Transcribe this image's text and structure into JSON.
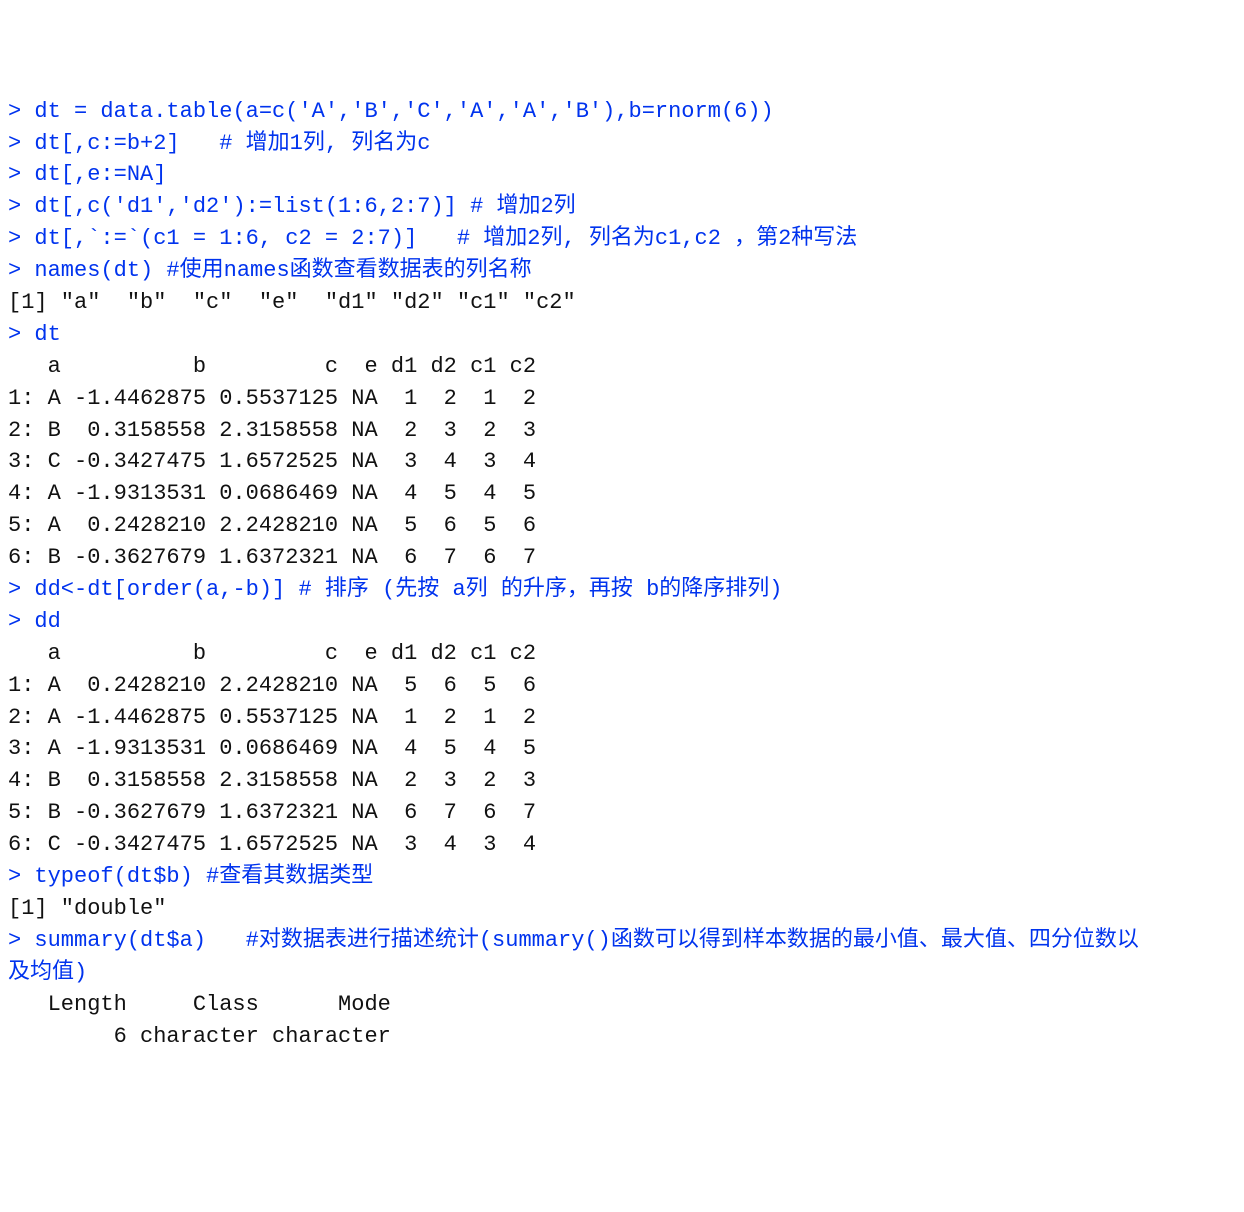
{
  "lines": [
    {
      "type": "cmd",
      "prompt": "> ",
      "text": "dt = data.table(a=c('A','B','C','A','A','B'),b=rnorm(6))"
    },
    {
      "type": "cmd",
      "prompt": "> ",
      "text": "dt[,c:=b+2]   # 增加1列, 列名为c"
    },
    {
      "type": "cmd",
      "prompt": "> ",
      "text": "dt[,e:=NA]"
    },
    {
      "type": "cmd",
      "prompt": "> ",
      "text": "dt[,c('d1','d2'):=list(1:6,2:7)] # 增加2列"
    },
    {
      "type": "cmd",
      "prompt": "> ",
      "text": "dt[,`:=`(c1 = 1:6, c2 = 2:7)]   # 增加2列, 列名为c1,c2 ，第2种写法"
    },
    {
      "type": "cmd",
      "prompt": "> ",
      "text": "names(dt) #使用names函数查看数据表的列名称"
    },
    {
      "type": "out",
      "text": "[1] \"a\"  \"b\"  \"c\"  \"e\"  \"d1\" \"d2\" \"c1\" \"c2\""
    },
    {
      "type": "cmd",
      "prompt": "> ",
      "text": "dt"
    },
    {
      "type": "out",
      "text": "   a          b         c  e d1 d2 c1 c2"
    },
    {
      "type": "out",
      "text": "1: A -1.4462875 0.5537125 NA  1  2  1  2"
    },
    {
      "type": "out",
      "text": "2: B  0.3158558 2.3158558 NA  2  3  2  3"
    },
    {
      "type": "out",
      "text": "3: C -0.3427475 1.6572525 NA  3  4  3  4"
    },
    {
      "type": "out",
      "text": "4: A -1.9313531 0.0686469 NA  4  5  4  5"
    },
    {
      "type": "out",
      "text": "5: A  0.2428210 2.2428210 NA  5  6  5  6"
    },
    {
      "type": "out",
      "text": "6: B -0.3627679 1.6372321 NA  6  7  6  7"
    },
    {
      "type": "cmd",
      "prompt": "> ",
      "text": "dd<-dt[order(a,-b)] # 排序 (先按 a列 的升序，再按 b的降序排列)"
    },
    {
      "type": "cmd",
      "prompt": "> ",
      "text": "dd"
    },
    {
      "type": "out",
      "text": "   a          b         c  e d1 d2 c1 c2"
    },
    {
      "type": "out",
      "text": "1: A  0.2428210 2.2428210 NA  5  6  5  6"
    },
    {
      "type": "out",
      "text": "2: A -1.4462875 0.5537125 NA  1  2  1  2"
    },
    {
      "type": "out",
      "text": "3: A -1.9313531 0.0686469 NA  4  5  4  5"
    },
    {
      "type": "out",
      "text": "4: B  0.3158558 2.3158558 NA  2  3  2  3"
    },
    {
      "type": "out",
      "text": "5: B -0.3627679 1.6372321 NA  6  7  6  7"
    },
    {
      "type": "out",
      "text": "6: C -0.3427475 1.6572525 NA  3  4  3  4"
    },
    {
      "type": "cmd",
      "prompt": "> ",
      "text": "typeof(dt$b) #查看其数据类型"
    },
    {
      "type": "out",
      "text": "[1] \"double\""
    },
    {
      "type": "cmd",
      "prompt": "> ",
      "text": "summary(dt$a)   #对数据表进行描述统计(summary()函数可以得到样本数据的最小值、最大值、四分位数以"
    },
    {
      "type": "cmd",
      "prompt": "",
      "text": "及均值)"
    },
    {
      "type": "out",
      "text": "   Length     Class      Mode "
    },
    {
      "type": "out",
      "text": "        6 character character "
    }
  ]
}
